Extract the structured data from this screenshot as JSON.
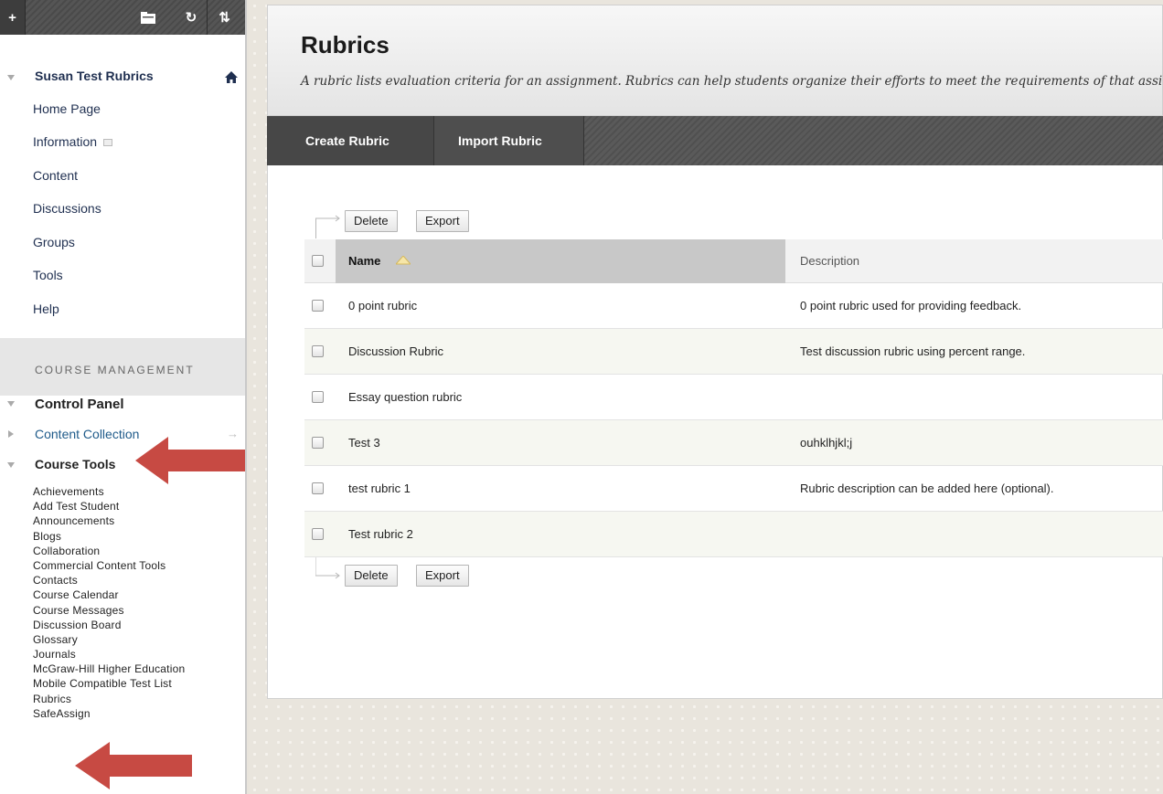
{
  "toolbar": {
    "add": "+",
    "folder_icon": "folder-icon",
    "refresh": "↻",
    "sort": "⇅"
  },
  "course": {
    "title": "Susan Test Rubrics",
    "menu": [
      "Home Page",
      "Information",
      "Content",
      "Discussions",
      "Groups",
      "Tools",
      "Help"
    ]
  },
  "management": {
    "header": "COURSE MANAGEMENT",
    "control_panel": "Control Panel",
    "content_collection": "Content Collection",
    "course_tools": "Course Tools",
    "tools": [
      "Achievements",
      "Add Test Student",
      "Announcements",
      "Blogs",
      "Collaboration",
      "Commercial Content Tools",
      "Contacts",
      "Course Calendar",
      "Course Messages",
      "Discussion Board",
      "Glossary",
      "Journals",
      "McGraw-Hill Higher Education",
      "Mobile Compatible Test List",
      "Rubrics",
      "SafeAssign"
    ]
  },
  "page": {
    "title": "Rubrics",
    "description": "A rubric lists evaluation criteria for an assignment. Rubrics can help students organize their efforts to meet the requirements of that assignment."
  },
  "actions": {
    "create": "Create Rubric",
    "import": "Import Rubric"
  },
  "table": {
    "delete_label": "Delete",
    "export_label": "Export",
    "col_name": "Name",
    "col_desc": "Description",
    "rows": [
      {
        "name": "0 point rubric",
        "desc": "0 point rubric used for providing feedback."
      },
      {
        "name": "Discussion Rubric",
        "desc": "Test discussion rubric using percent range."
      },
      {
        "name": "Essay question rubric",
        "desc": ""
      },
      {
        "name": "Test 3",
        "desc": "ouhklhjkl;j"
      },
      {
        "name": "test rubric 1",
        "desc": "Rubric description can be added here (optional)."
      },
      {
        "name": "Test rubric 2",
        "desc": ""
      }
    ]
  },
  "colors": {
    "annotation_arrow": "#c74a43",
    "link": "#1f5b8a"
  }
}
